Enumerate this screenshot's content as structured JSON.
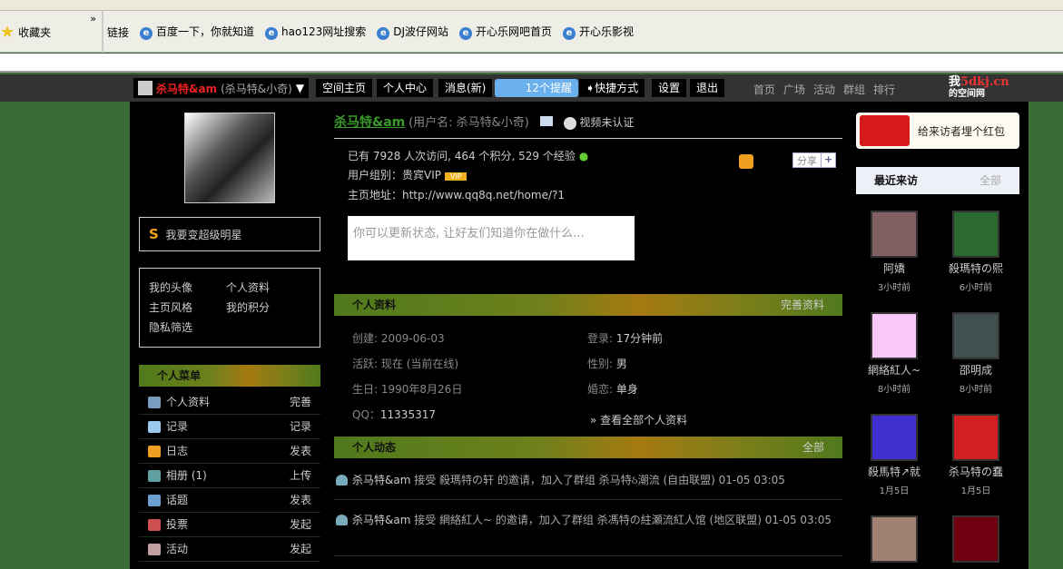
{
  "browser": {
    "favorites": "收藏夹",
    "links_label": "链接",
    "links": [
      "百度一下，你就知道",
      "hao123网址搜索",
      "DJ波仔网站",
      "开心乐网吧首页",
      "开心乐影视"
    ]
  },
  "topbar": {
    "user_name": "杀马特&am",
    "user_alias": "(杀马特&小奇)",
    "buttons": [
      "空间主页",
      "个人中心",
      "消息(新)",
      "12个提醒",
      "快捷方式",
      "设置",
      "退出"
    ],
    "site_nav": [
      "首页",
      "广场",
      "活动",
      "群组",
      "排行"
    ],
    "logo_main": "我",
    "logo_domain": "5dkj.cn",
    "logo_sub": "的空间网"
  },
  "profile": {
    "name": "杀马特&am",
    "username": "(用户名: 杀马特&小奇)",
    "video": "视频未认证",
    "stats": "已有  7928 人次访问, 464 个积分, 529 个经验",
    "group": "用户组别：贵宾VIP",
    "vip_badge": "VIP",
    "homepage": "主页地址：http://www.qq8q.net/home/?1",
    "status_placeholder": "你可以更新状态, 让好友们知道你在做什么...",
    "share": "分享",
    "share_plus": "+"
  },
  "left": {
    "star": "我要变超级明星",
    "links": [
      "我的头像",
      "个人资料",
      "主页风格",
      "我的积分",
      "隐私筛选"
    ],
    "menu_title": "个人菜单",
    "menu": [
      {
        "label": "个人资料",
        "action": "完善",
        "color": "#7a9cc0"
      },
      {
        "label": "记录",
        "action": "记录",
        "color": "#9cc8f0"
      },
      {
        "label": "日志",
        "action": "发表",
        "color": "#f0a020"
      },
      {
        "label": "相册 (1)",
        "action": "上传",
        "color": "#60a0a0"
      },
      {
        "label": "话题",
        "action": "发表",
        "color": "#6aa0d0"
      },
      {
        "label": "投票",
        "action": "发起",
        "color": "#d05050"
      },
      {
        "label": "活动",
        "action": "发起",
        "color": "#c0a0a0"
      }
    ]
  },
  "info": {
    "title": "个人资料",
    "more": "完善资料",
    "created_l": "创建:",
    "created": "2009-06-03",
    "login_l": "登录:",
    "login": "17分钟前",
    "active_l": "活跃:",
    "active": "现在 (当前在线)",
    "gender_l": "性别:",
    "gender": "男",
    "birthday_l": "生日:",
    "birthday": "1990年8月26日",
    "marital_l": "婚恋:",
    "marital": "单身",
    "qq_l": "QQ：",
    "qq": "11335317",
    "view_all": "» 查看全部个人资料"
  },
  "feed": {
    "title": "个人动态",
    "more": "全部",
    "items": [
      {
        "user": "杀马特&am",
        "text": "接受 殺瑪特の轩 的邀请，加入了群组 杀马特ઠ潮流 (自由联盟) 01-05 03:05"
      },
      {
        "user": "杀马特&am",
        "text": "接受 網絡紅人~ 的邀请，加入了群组 杀馮特の紸瀬流紅人馆 (地区联盟) 01-05 03:05"
      }
    ]
  },
  "right": {
    "redpacket": "给来访者埋个红包",
    "visitors_title": "最近来访",
    "visitors_more": "全部",
    "visitors": [
      {
        "name": "阿嬌",
        "time": "3小时前",
        "color": "#806060"
      },
      {
        "name": "殺瑪特の熙",
        "time": "6小时前",
        "color": "#2a6a30"
      },
      {
        "name": "網絡紅人~",
        "time": "8小时前",
        "color": "#f8c8f8"
      },
      {
        "name": "邵明成",
        "time": "8小时前",
        "color": "#405050"
      },
      {
        "name": "殺馬特↗就",
        "time": "1月5日",
        "color": "#4030d0"
      },
      {
        "name": "杀马特の蠢",
        "time": "1月5日",
        "color": "#d02020"
      },
      {
        "name": "",
        "time": "",
        "color": "#a08070"
      },
      {
        "name": "",
        "time": "",
        "color": "#700010"
      }
    ]
  }
}
